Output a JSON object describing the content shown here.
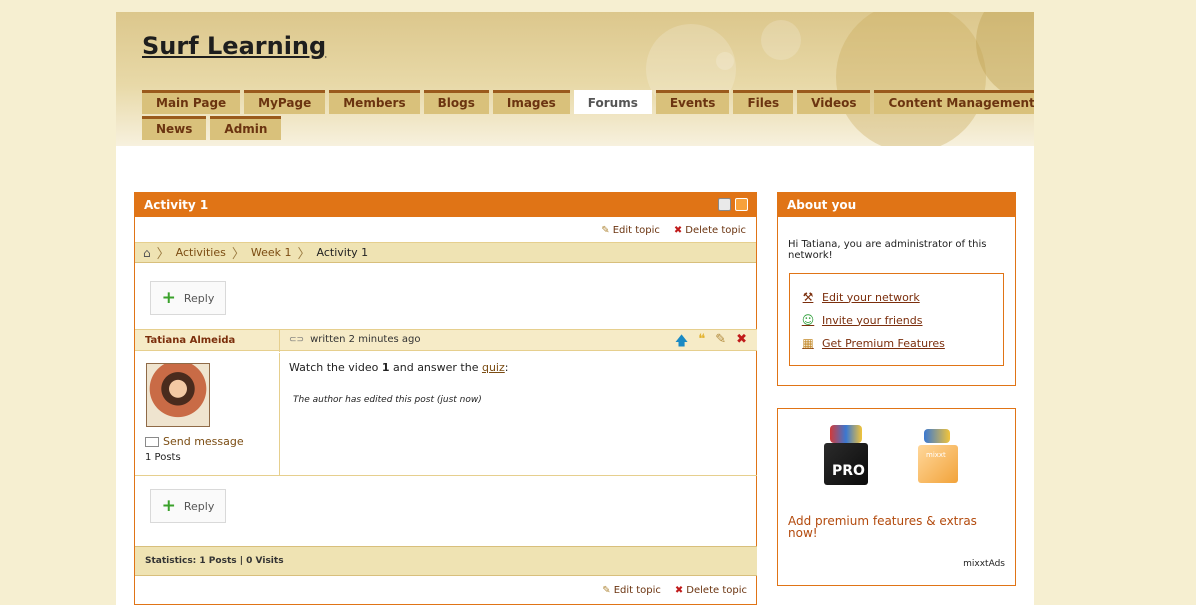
{
  "site": {
    "title": "Surf Learning"
  },
  "nav": {
    "row1": [
      "Main Page",
      "MyPage",
      "Members",
      "Blogs",
      "Images",
      "Forums",
      "Events",
      "Files",
      "Videos",
      "Content Management"
    ],
    "row2": [
      "News",
      "Admin"
    ],
    "active": "Forums"
  },
  "topic": {
    "title": "Activity 1",
    "edit_label": "Edit topic",
    "delete_label": "Delete topic",
    "breadcrumb": [
      "Activities",
      "Week 1",
      "Activity 1"
    ],
    "reply_label": "Reply",
    "post": {
      "author": "Tatiana Almeida",
      "written": "written 2 minutes ago",
      "body_pre": "Watch the video ",
      "body_bold": "1",
      "body_mid": " and answer the ",
      "body_link": "quiz",
      "body_post": ":",
      "edited_note": "The author has edited this post (just now)",
      "send_message": "Send message",
      "posts_count": "1 Posts"
    },
    "statistics": "Statistics: 1 Posts | 0 Visits"
  },
  "about": {
    "title": "About you",
    "text": "Hi Tatiana, you are administrator of this network!",
    "links": [
      "Edit your network",
      "Invite your friends",
      "Get Premium Features"
    ]
  },
  "ad": {
    "pro_label": "PRO",
    "brand_small": "mixxt",
    "text": "Add premium features & extras now!",
    "brand": "mixxtAds"
  }
}
